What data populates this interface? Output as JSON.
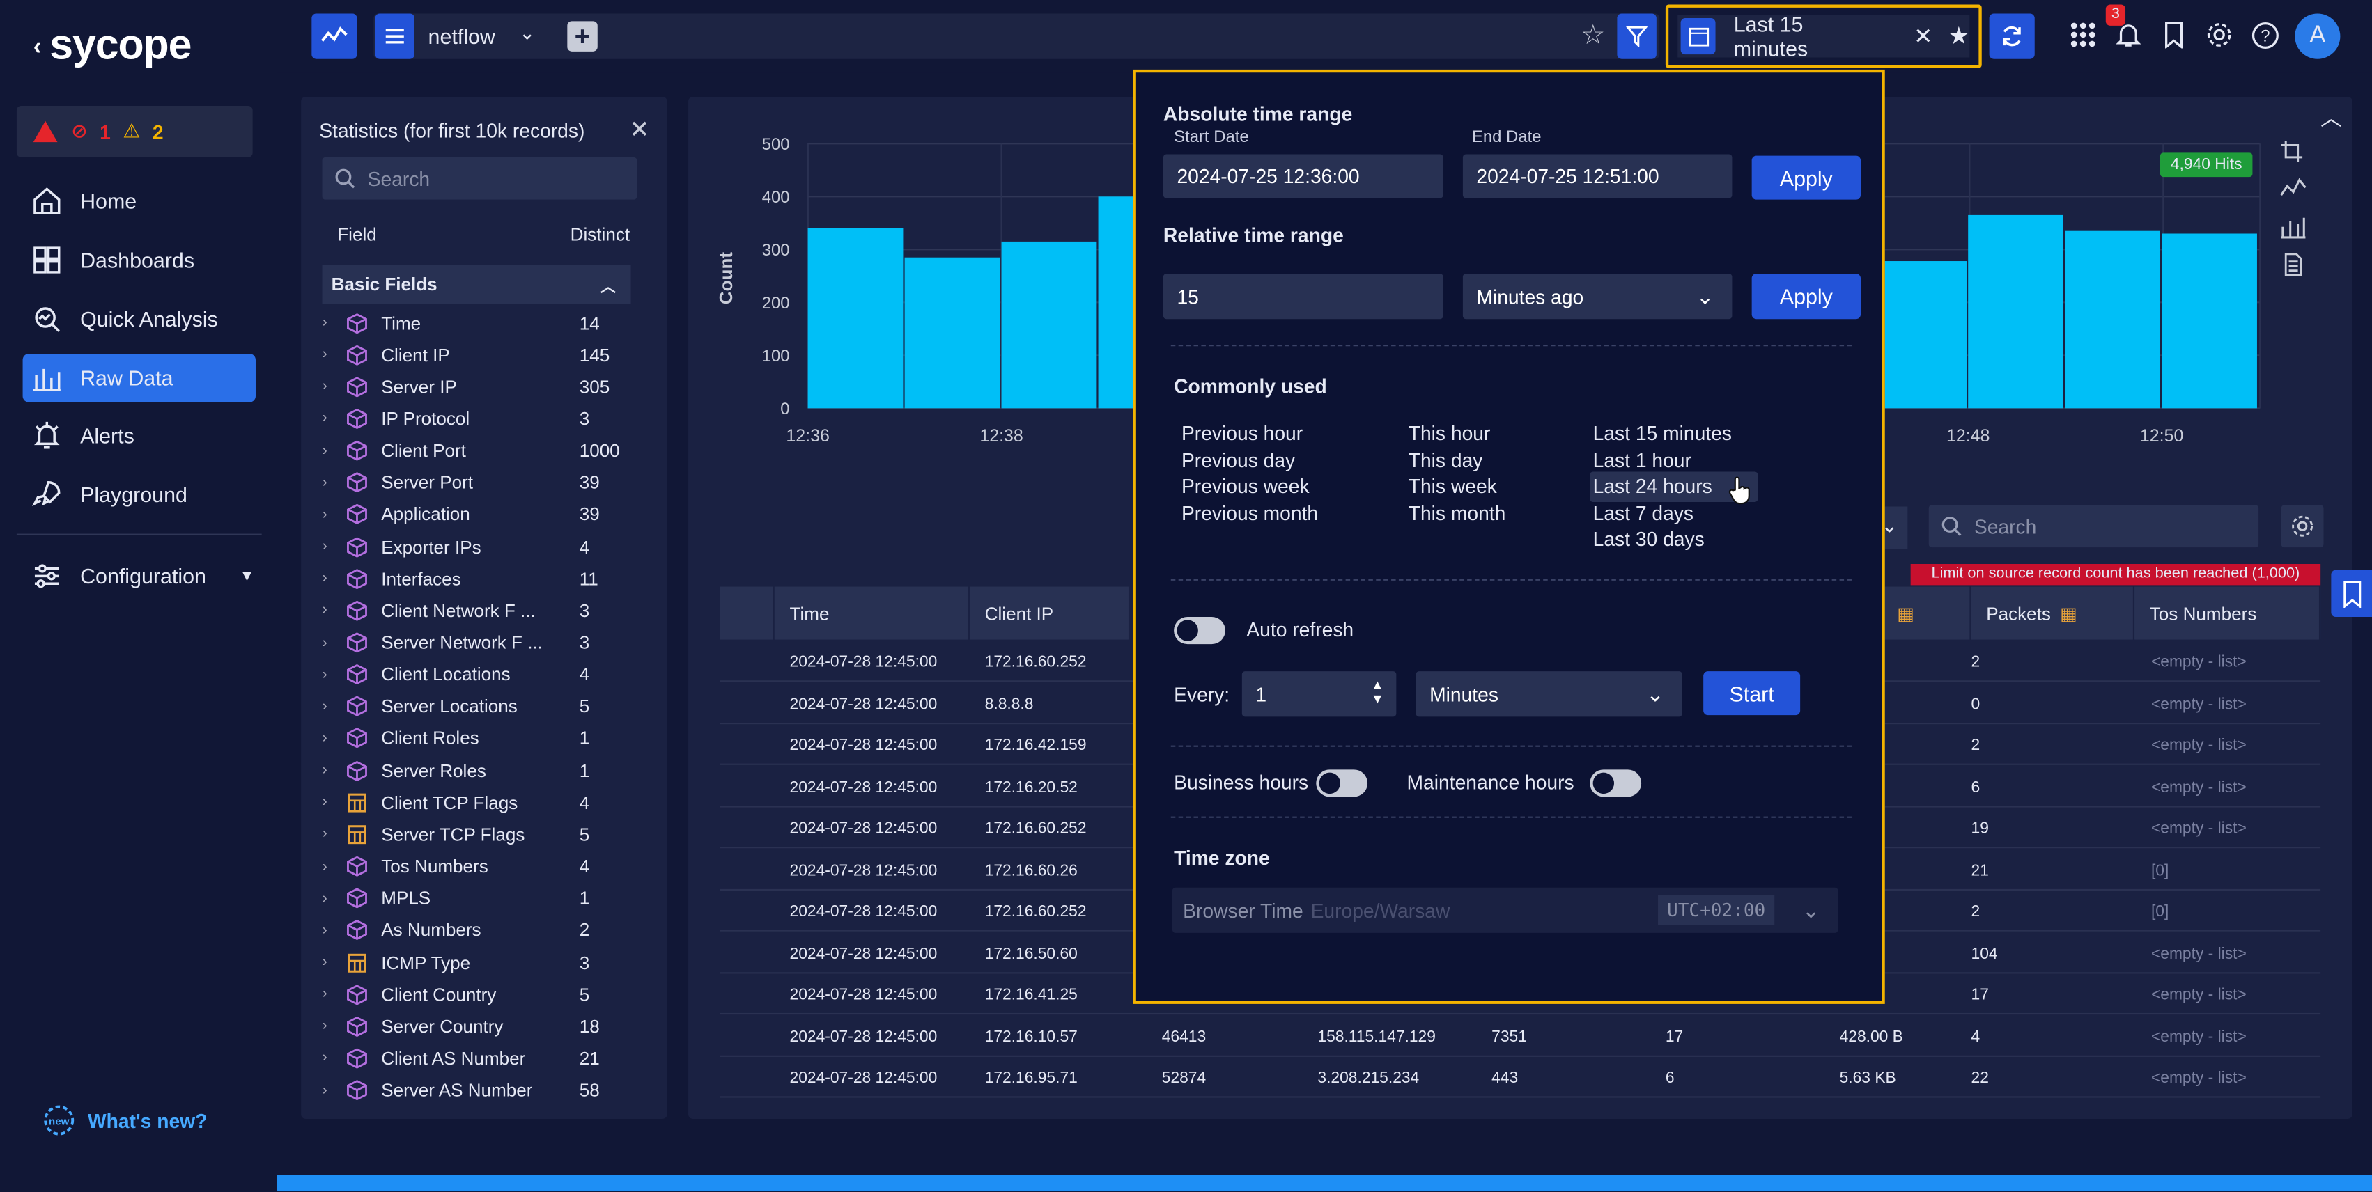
{
  "app": {
    "logo": "sycope"
  },
  "alerts": {
    "errors": "1",
    "warnings": "2"
  },
  "nav": [
    {
      "label": "Home",
      "icon": "home-icon"
    },
    {
      "label": "Dashboards",
      "icon": "dashboards-icon"
    },
    {
      "label": "Quick Analysis",
      "icon": "quick-analysis-icon"
    },
    {
      "label": "Raw Data",
      "icon": "raw-data-icon",
      "active": true
    },
    {
      "label": "Alerts",
      "icon": "alerts-icon"
    },
    {
      "label": "Playground",
      "icon": "playground-icon"
    }
  ],
  "config": {
    "label": "Configuration"
  },
  "whats_new": "What's new?",
  "topbar": {
    "source": "netflow",
    "time_label": "Last 15 minutes",
    "notifications": "3",
    "avatar": "A"
  },
  "stats": {
    "title": "Statistics (for first 10k records)",
    "search_placeholder": "Search",
    "col_field": "Field",
    "col_distinct": "Distinct",
    "section": "Basic Fields",
    "fields": [
      {
        "name": "Time",
        "count": "14",
        "type": "cube"
      },
      {
        "name": "Client IP",
        "count": "145",
        "type": "cube"
      },
      {
        "name": "Server IP",
        "count": "305",
        "type": "cube"
      },
      {
        "name": "IP Protocol",
        "count": "3",
        "type": "cube"
      },
      {
        "name": "Client Port",
        "count": "1000",
        "type": "cube"
      },
      {
        "name": "Server Port",
        "count": "39",
        "type": "cube"
      },
      {
        "name": "Application",
        "count": "39",
        "type": "cube"
      },
      {
        "name": "Exporter IPs",
        "count": "4",
        "type": "cube"
      },
      {
        "name": "Interfaces",
        "count": "11",
        "type": "cube"
      },
      {
        "name": "Client Network F ...",
        "count": "3",
        "type": "cube"
      },
      {
        "name": "Server Network F ...",
        "count": "3",
        "type": "cube"
      },
      {
        "name": "Client Locations",
        "count": "4",
        "type": "cube"
      },
      {
        "name": "Server Locations",
        "count": "5",
        "type": "cube"
      },
      {
        "name": "Client Roles",
        "count": "1",
        "type": "cube"
      },
      {
        "name": "Server Roles",
        "count": "1",
        "type": "cube"
      },
      {
        "name": "Client TCP Flags",
        "count": "4",
        "type": "calc"
      },
      {
        "name": "Server TCP Flags",
        "count": "5",
        "type": "calc"
      },
      {
        "name": "Tos Numbers",
        "count": "4",
        "type": "cube"
      },
      {
        "name": "MPLS",
        "count": "1",
        "type": "cube"
      },
      {
        "name": "As Numbers",
        "count": "2",
        "type": "cube"
      },
      {
        "name": "ICMP Type",
        "count": "3",
        "type": "calc"
      },
      {
        "name": "Client Country",
        "count": "5",
        "type": "cube"
      },
      {
        "name": "Server Country",
        "count": "18",
        "type": "cube"
      },
      {
        "name": "Client AS Number",
        "count": "21",
        "type": "cube"
      },
      {
        "name": "Server AS Number",
        "count": "58",
        "type": "cube"
      }
    ]
  },
  "chart_data": {
    "type": "bar",
    "ylabel": "Count",
    "ylim": [
      0,
      500
    ],
    "yticks": [
      "500",
      "400",
      "300",
      "200",
      "100",
      "0"
    ],
    "xticks_left": [
      "12:36",
      "12:38"
    ],
    "xticks_right": [
      "12:48",
      "12:50"
    ],
    "values_left": [
      340,
      285,
      315,
      400
    ],
    "values_right": [
      278,
      365,
      335,
      330
    ],
    "hits": "4,940 Hits"
  },
  "main": {
    "search_placeholder": "Search",
    "limit_msg": "Limit on source record count has been reached (1,000)",
    "columns": [
      "Time",
      "Client IP",
      "Packets",
      "Tos Numbers"
    ],
    "rows": [
      {
        "time": "2024-07-28 12:45:00",
        "client_ip": "172.16.60.252",
        "c3": "",
        "c4": "",
        "c5": "",
        "c6": "",
        "bytes": "B",
        "packets": "2",
        "tos": "<empty - list>"
      },
      {
        "time": "2024-07-28 12:45:00",
        "client_ip": "8.8.8.8",
        "c3": "",
        "c4": "",
        "c5": "",
        "c6": "",
        "bytes": "",
        "packets": "0",
        "tos": "<empty - list>"
      },
      {
        "time": "2024-07-28 12:45:00",
        "client_ip": "172.16.42.159",
        "c3": "",
        "c4": "",
        "c5": "",
        "c6": "",
        "bytes": "B",
        "packets": "2",
        "tos": "<empty - list>"
      },
      {
        "time": "2024-07-28 12:45:00",
        "client_ip": "172.16.20.52",
        "c3": "",
        "c4": "",
        "c5": "",
        "c6": "",
        "bytes": "B",
        "packets": "6",
        "tos": "<empty - list>"
      },
      {
        "time": "2024-07-28 12:45:00",
        "client_ip": "172.16.60.252",
        "c3": "",
        "c4": "",
        "c5": "",
        "c6": "",
        "bytes": "B",
        "packets": "19",
        "tos": "<empty - list>"
      },
      {
        "time": "2024-07-28 12:45:00",
        "client_ip": "172.16.60.26",
        "c3": "",
        "c4": "",
        "c5": "",
        "c6": "",
        "bytes": "B",
        "packets": "21",
        "tos": "[0]"
      },
      {
        "time": "2024-07-28 12:45:00",
        "client_ip": "172.16.60.252",
        "c3": "",
        "c4": "",
        "c5": "",
        "c6": "",
        "bytes": "B",
        "packets": "2",
        "tos": "[0]"
      },
      {
        "time": "2024-07-28 12:45:00",
        "client_ip": "172.16.50.60",
        "c3": "",
        "c4": "",
        "c5": "",
        "c6": "",
        "bytes": "B",
        "packets": "104",
        "tos": "<empty - list>"
      },
      {
        "time": "2024-07-28 12:45:00",
        "client_ip": "172.16.41.25",
        "c3": "",
        "c4": "",
        "c5": "",
        "c6": "",
        "bytes": "",
        "packets": "17",
        "tos": "<empty - list>"
      },
      {
        "time": "2024-07-28 12:45:00",
        "client_ip": "172.16.10.57",
        "c3": "46413",
        "c4": "158.115.147.129",
        "c5": "7351",
        "c6": "17",
        "bytes": "428.00 B",
        "packets": "4",
        "tos": "<empty - list>"
      },
      {
        "time": "2024-07-28 12:45:00",
        "client_ip": "172.16.95.71",
        "c3": "52874",
        "c4": "3.208.215.234",
        "c5": "443",
        "c6": "6",
        "bytes": "5.63 KB",
        "packets": "22",
        "tos": "<empty - list>"
      }
    ]
  },
  "popup": {
    "abs_title": "Absolute time range",
    "start_label": "Start Date",
    "start_value": "2024-07-25 12:36:00",
    "end_label": "End Date",
    "end_value": "2024-07-25 12:51:00",
    "apply": "Apply",
    "rel_title": "Relative time range",
    "rel_value": "15",
    "rel_unit": "Minutes ago",
    "common_title": "Commonly used",
    "common_col1": [
      "Previous hour",
      "Previous day",
      "Previous week",
      "Previous month"
    ],
    "common_col2": [
      "This hour",
      "This day",
      "This week",
      "This month"
    ],
    "common_col3": [
      "Last 15 minutes",
      "Last 1 hour",
      "Last 24 hours",
      "Last 7 days",
      "Last 30 days"
    ],
    "auto_refresh": "Auto refresh",
    "every": "Every:",
    "every_value": "1",
    "every_unit": "Minutes",
    "start": "Start",
    "business_hours": "Business hours",
    "maintenance_hours": "Maintenance hours",
    "tz_title": "Time zone",
    "tz_value": "Browser Time",
    "tz_zone": "Europe/Warsaw",
    "tz_offset": "UTC+02:00"
  },
  "colors": {
    "accent": "#2353d8",
    "bar": "#00bff7",
    "highlight": "#f4b400",
    "hits": "#1f9d3a",
    "limit": "#c8102e"
  }
}
